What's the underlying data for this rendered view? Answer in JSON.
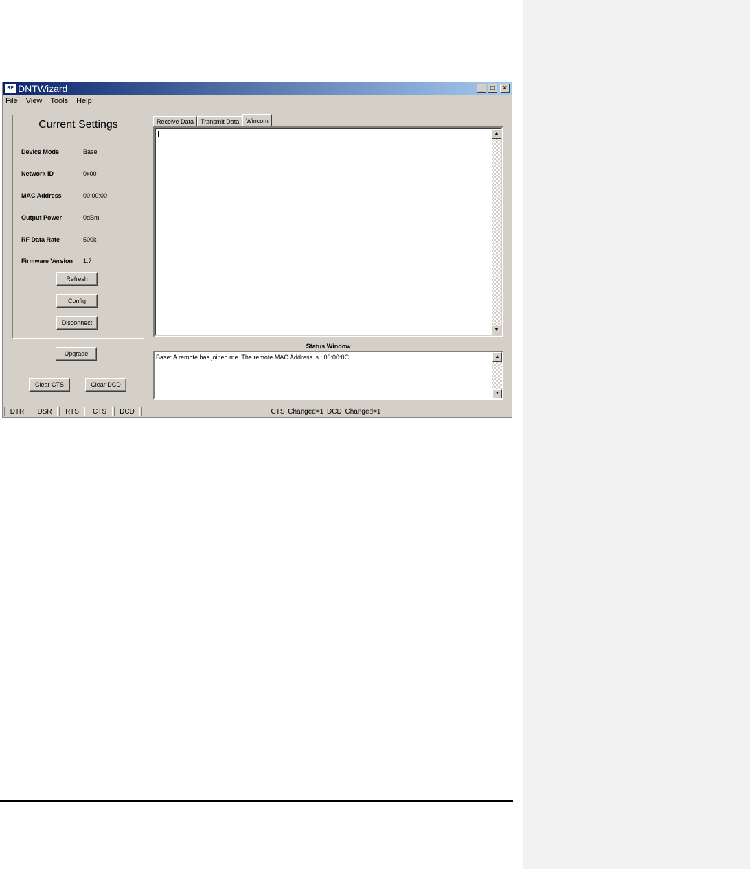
{
  "window": {
    "title": "DNTWizard",
    "icon": "app-icon"
  },
  "menu": [
    "File",
    "View",
    "Tools",
    "Help"
  ],
  "settings": {
    "title": "Current Settings",
    "rows": [
      {
        "label": "Device Mode",
        "value": "Base"
      },
      {
        "label": "Network ID",
        "value": "0x00"
      },
      {
        "label": "MAC Address",
        "value": "00:00:00"
      },
      {
        "label": "Output Power",
        "value": "0dBm"
      },
      {
        "label": "RF Data Rate",
        "value": "500k"
      },
      {
        "label": "Firmware Version",
        "value": "1.7"
      }
    ],
    "buttons": {
      "refresh": "Refresh",
      "config": "Config",
      "disconnect": "Disconnect"
    }
  },
  "upgrade_label": "Upgrade",
  "clear_cts_label": "Clear CTS",
  "clear_dcd_label": "Clear DCD",
  "tabs": [
    {
      "label": "Receive Data",
      "active": false
    },
    {
      "label": "Transmit Data",
      "active": false
    },
    {
      "label": "Wincom",
      "active": true
    }
  ],
  "status_window": {
    "title": "Status Window",
    "text": "Base: A remote has joined me.  The remote MAC Address is : 00:00:0C"
  },
  "statusbar": {
    "indicators": [
      "DTR",
      "DSR",
      "RTS",
      "CTS",
      "DCD"
    ],
    "message": "CTS Changed=1     DCD Changed=1"
  }
}
